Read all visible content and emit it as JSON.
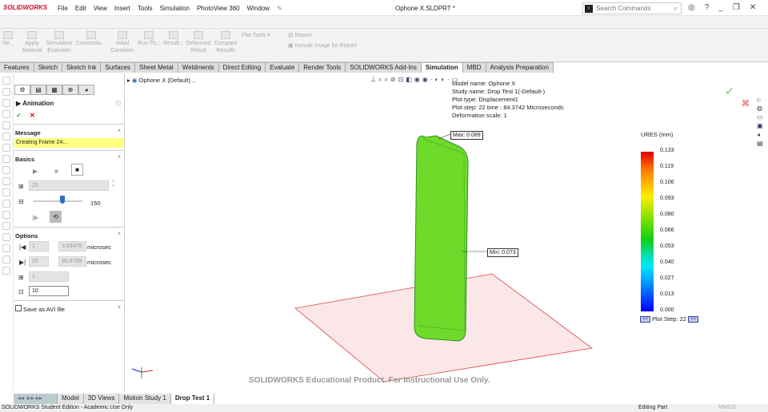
{
  "app": {
    "brand": "SOLIDWORKS",
    "document_title": "Ophone X.SLDPRT *"
  },
  "menu": [
    "File",
    "Edit",
    "View",
    "Insert",
    "Tools",
    "Simulation",
    "PhotoView 360",
    "Window"
  ],
  "search": {
    "placeholder": "Search Commands"
  },
  "ribbon": {
    "items": [
      "Ne...",
      "Apply Material",
      "Simulation Evaluator",
      "Connectio...",
      "Initial Condition",
      "Run Th...",
      "Result...",
      "Deformed Result",
      "Compare Results"
    ],
    "plot_tools": "Plot Tools",
    "report": "Report",
    "include_image": "Include Image for Report"
  },
  "tabs": [
    "Features",
    "Sketch",
    "Sketch Ink",
    "Surfaces",
    "Sheet Metal",
    "Weldments",
    "Direct Editing",
    "Evaluate",
    "Render Tools",
    "SOLIDWORKS Add-Ins",
    "Simulation",
    "MBD",
    "Analysis Preparation"
  ],
  "active_tab": "Simulation",
  "pm": {
    "title": "Animation",
    "message_header": "Message",
    "message": "Creating Frame 24...",
    "basics_header": "Basics",
    "frames": "25",
    "speed": "150",
    "speed_fraction": 0.6,
    "options_header": "Options",
    "start_frame": "1",
    "start_time": "3.83478",
    "end_frame": "25",
    "end_time": "95.8799",
    "unit": "microsec",
    "field3": "1",
    "field4": "10",
    "save_avi": "Save as AVI file"
  },
  "tree": {
    "root": "Ophone X  (Default) .."
  },
  "plot_info": [
    "Model name: Ophone X",
    "Study name: Drop Test 1(-Default-)",
    "Plot type:  Displacement1",
    "Plot step: 22    time : 84.3742 Microseconds",
    "Deformation scale: 1"
  ],
  "max_label": "Max: 0.089",
  "min_label": "Min: 0.073",
  "legend": {
    "title": "URES (mm)",
    "ticks": [
      "0.133",
      "0.119",
      "0.106",
      "0.093",
      "0.080",
      "0.066",
      "0.053",
      "0.040",
      "0.027",
      "0.013",
      "0.000"
    ],
    "plot_step": "Plot Step: 22",
    "prev": "<<",
    "next": ">>"
  },
  "watermark": "SOLIDWORKS Educational Product. For Instructional Use Only.",
  "bottom_tabs": [
    "Model",
    "3D Views",
    "Motion Study 1",
    "Drop Test 1"
  ],
  "status": {
    "left": "SOLIDWORKS Student Edition - Academic Use Only",
    "editing": "Editing Part",
    "units": "MMGS"
  }
}
